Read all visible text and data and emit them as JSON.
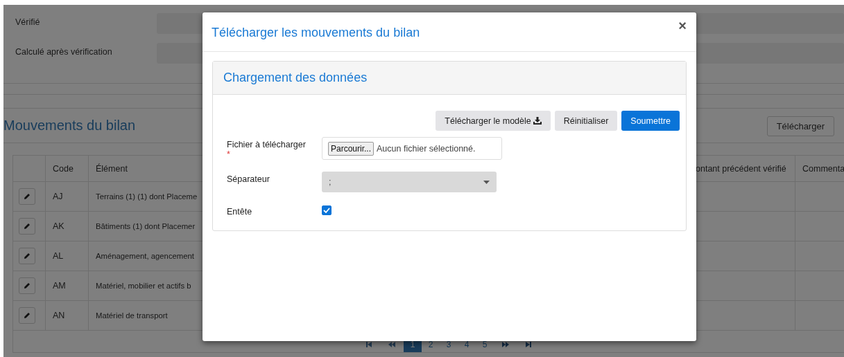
{
  "background": {
    "fields": [
      {
        "label": "Vérifié"
      },
      {
        "label": "Calculé après vérification"
      }
    ],
    "section_title": "Mouvements du bilan",
    "download_button": "Télécharger",
    "table": {
      "columns": [
        "Code",
        "Élément",
        "ontant précédent vérifié",
        "Commenta"
      ],
      "rows": [
        {
          "code": "AJ",
          "element": "Terrains (1) (1) dont Placeme"
        },
        {
          "code": "AK",
          "element": "Bâtiments (1) dont Placemer"
        },
        {
          "code": "AL",
          "element": "Aménagement, agencement"
        },
        {
          "code": "AM",
          "element": "Matériel, mobilier et actifs b"
        },
        {
          "code": "AN",
          "element": "Matériel de transport"
        }
      ]
    },
    "pagination": {
      "pages": [
        {
          "label": "1",
          "selected": true
        },
        {
          "label": "2",
          "selected": false
        },
        {
          "label": "3",
          "selected": false
        },
        {
          "label": "4",
          "selected": false
        },
        {
          "label": "5",
          "selected": false
        }
      ]
    }
  },
  "modal": {
    "title": "Télécharger les mouvements du bilan",
    "close": "×",
    "panel": {
      "title": "Chargement des données",
      "buttons": [
        {
          "label": "Télécharger le modèle",
          "kind": "download"
        },
        {
          "label": "Réinitialiser",
          "kind": "secondary"
        },
        {
          "label": "Soumettre",
          "kind": "primary"
        }
      ],
      "fields": [
        {
          "kind": "file",
          "label": "Fichier à télécharger",
          "required": true,
          "required_mark": "*",
          "button": "Parcourir...",
          "value": "Aucun fichier sélectionné."
        },
        {
          "kind": "select",
          "label": "Séparateur",
          "value": ";"
        },
        {
          "kind": "checkbox",
          "label": "Entête",
          "checked": true
        }
      ]
    }
  }
}
